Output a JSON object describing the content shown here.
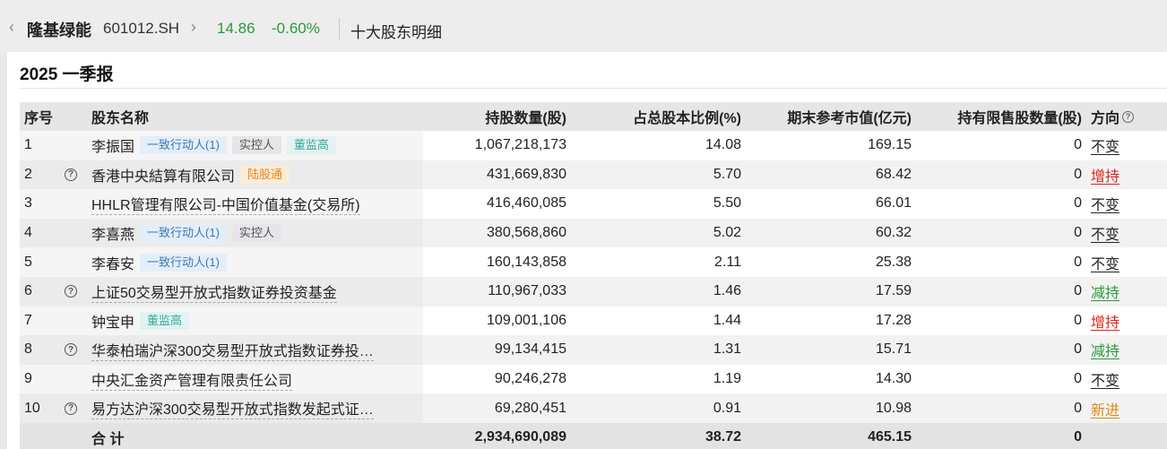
{
  "header": {
    "back_icon": "chevron-left-icon",
    "stock_name": "隆基绿能",
    "stock_code": "601012.SH",
    "price": "14.86",
    "change": "-0.60%",
    "page_title": "十大股东明细",
    "price_color": "#2a9a3a"
  },
  "period": "2025 一季报",
  "columns": {
    "no": "序号",
    "name": "股东名称",
    "shares": "持股数量(股)",
    "pct": "占总股本比例(%)",
    "value": "期末参考市值(亿元)",
    "restricted": "持有限售股数量(股)",
    "direction": "方向"
  },
  "rows": [
    {
      "no": "1",
      "name": "李振国",
      "tags": [
        "一致行动人(1)",
        "实控人",
        "董监高"
      ],
      "shares": "1,067,218,173",
      "pct": "14.08",
      "value": "169.15",
      "restricted": "0",
      "direction": "不变"
    },
    {
      "no": "2",
      "name": "香港中央結算有限公司",
      "tags": [
        "陆股通"
      ],
      "shares": "431,669,830",
      "pct": "5.70",
      "value": "68.42",
      "restricted": "0",
      "direction": "增持"
    },
    {
      "no": "3",
      "name": "HHLR管理有限公司-中国价值基金(交易所)",
      "tags": [],
      "shares": "416,460,085",
      "pct": "5.50",
      "value": "66.01",
      "restricted": "0",
      "direction": "不变"
    },
    {
      "no": "4",
      "name": "李喜燕",
      "tags": [
        "一致行动人(1)",
        "实控人"
      ],
      "shares": "380,568,860",
      "pct": "5.02",
      "value": "60.32",
      "restricted": "0",
      "direction": "不变"
    },
    {
      "no": "5",
      "name": "李春安",
      "tags": [
        "一致行动人(1)"
      ],
      "shares": "160,143,858",
      "pct": "2.11",
      "value": "25.38",
      "restricted": "0",
      "direction": "不变"
    },
    {
      "no": "6",
      "name": "上证50交易型开放式指数证券投资基金",
      "tags": [],
      "shares": "110,967,033",
      "pct": "1.46",
      "value": "17.59",
      "restricted": "0",
      "direction": "减持"
    },
    {
      "no": "7",
      "name": "钟宝申",
      "tags": [
        "董监高"
      ],
      "shares": "109,001,106",
      "pct": "1.44",
      "value": "17.28",
      "restricted": "0",
      "direction": "增持"
    },
    {
      "no": "8",
      "name": "华泰柏瑞沪深300交易型开放式指数证券投…",
      "tags": [],
      "shares": "99,134,415",
      "pct": "1.31",
      "value": "15.71",
      "restricted": "0",
      "direction": "减持"
    },
    {
      "no": "9",
      "name": "中央汇金资产管理有限责任公司",
      "tags": [],
      "shares": "90,246,278",
      "pct": "1.19",
      "value": "14.30",
      "restricted": "0",
      "direction": "不变"
    },
    {
      "no": "10",
      "name": "易方达沪深300交易型开放式指数发起式证…",
      "tags": [],
      "shares": "69,280,451",
      "pct": "0.91",
      "value": "10.98",
      "restricted": "0",
      "direction": "新进"
    }
  ],
  "total": {
    "label": "合 计",
    "shares": "2,934,690,089",
    "pct": "38.72",
    "value": "465.15",
    "restricted": "0"
  },
  "colors": {
    "increase": "#d8261c",
    "decrease": "#2a9a3a",
    "new": "#e08a1c"
  }
}
